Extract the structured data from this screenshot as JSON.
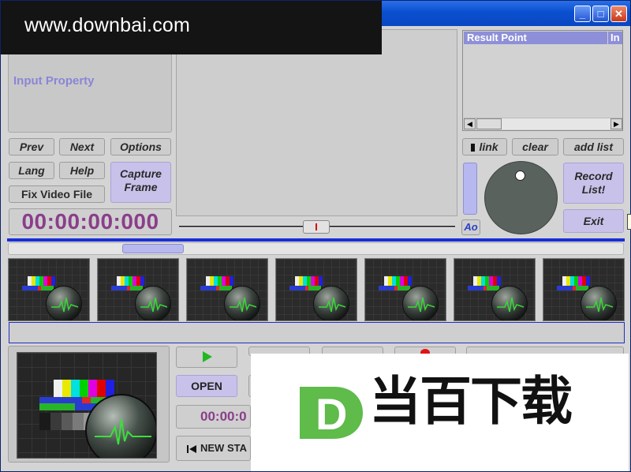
{
  "watermark": {
    "banner_text": "www.downbai.com",
    "brand_letter": "D",
    "brand_text": "当百下载",
    "brand_color": "#5fbb4a"
  },
  "window_controls": {
    "minimize": "_",
    "maximize": "□",
    "close": "✕"
  },
  "input_panel": {
    "label": "Input Property"
  },
  "buttons": {
    "prev": "Prev",
    "next": "Next",
    "options": "Options",
    "lang": "Lang",
    "help": "Help",
    "capture": "Capture Frame",
    "fix_video": "Fix Video File",
    "link": "link",
    "clear": "clear",
    "add_list": "add list",
    "record_list": "Record List!",
    "exit": "Exit",
    "open": "OPEN",
    "new_start": "NEW STA"
  },
  "timecode": "00:00:00:000",
  "timecode_small": "00:00:0",
  "result_list": {
    "columns": [
      "Result Point",
      "In"
    ]
  },
  "audio": {
    "ao_label": "Ao"
  },
  "thumbnails": {
    "count": 7
  },
  "test_bar_colors": [
    "#f0f0f0",
    "#e8e800",
    "#00e0e0",
    "#00d000",
    "#e000e0",
    "#e00000",
    "#2020e0"
  ],
  "accent": "#1a2fd6",
  "timecode_color": "#8a3e8a"
}
